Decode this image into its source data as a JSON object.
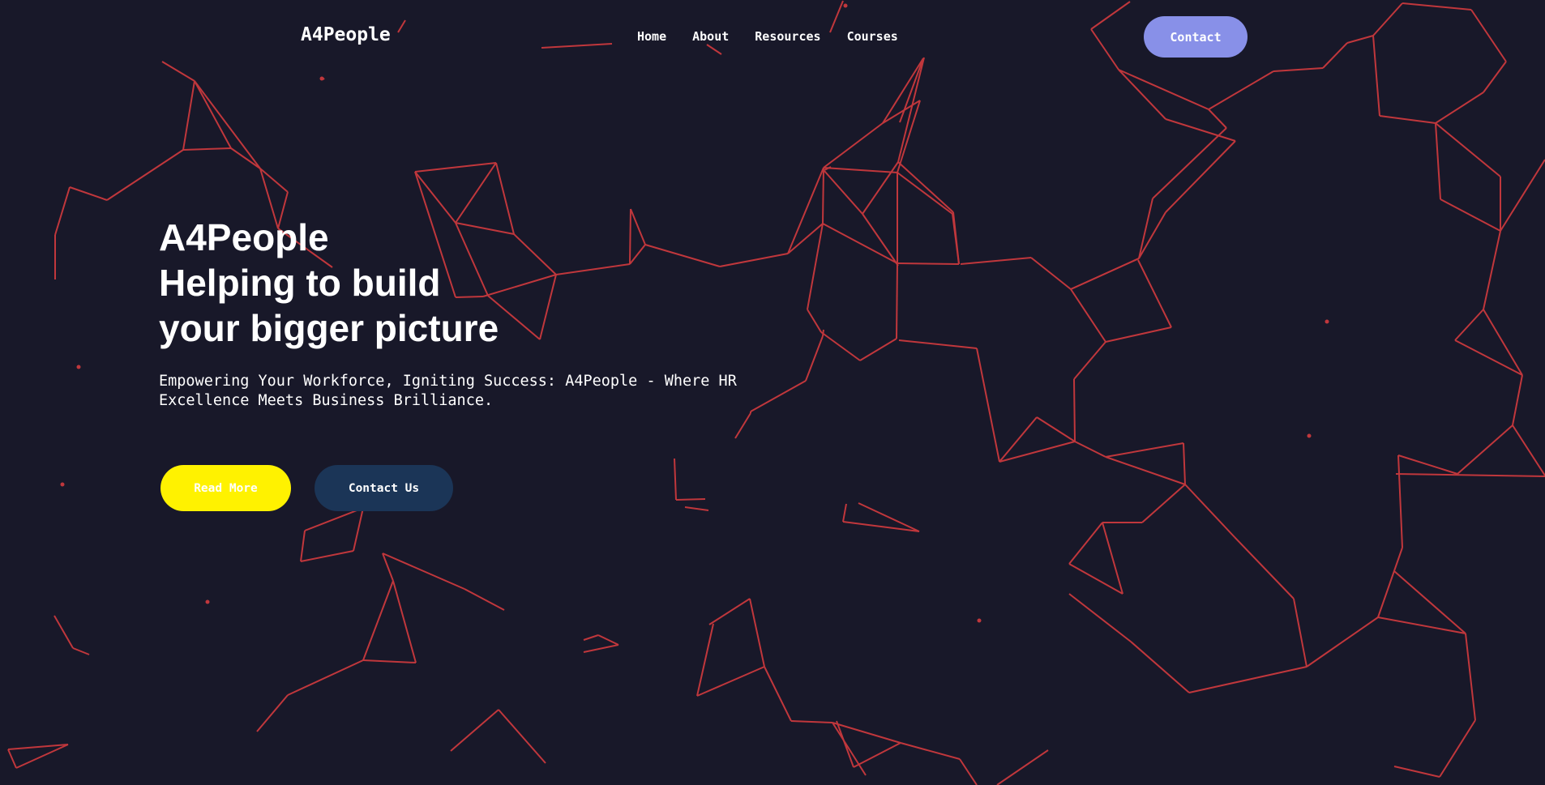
{
  "brand": {
    "name": "A4People"
  },
  "nav": {
    "items": [
      {
        "label": "Home"
      },
      {
        "label": "About"
      },
      {
        "label": "Resources"
      },
      {
        "label": "Courses"
      }
    ],
    "contact_label": "Contact"
  },
  "hero": {
    "title_lines": [
      "A4People",
      "Helping to build",
      "your bigger picture"
    ],
    "subtitle": "Empowering Your Workforce, Igniting Success: A4People - Where HR Excellence Meets Business Brilliance.",
    "read_more_label": "Read More",
    "contact_us_label": "Contact Us"
  },
  "colors": {
    "background": "#181829",
    "network_line": "#c0373c",
    "contact_pill": "#8890e8",
    "read_more": "#fff200",
    "contact_us": "#1b3557"
  }
}
